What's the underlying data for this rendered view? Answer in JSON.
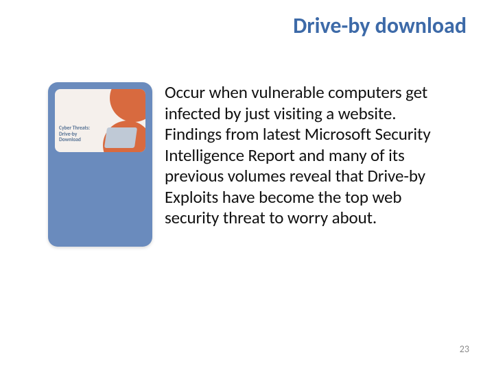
{
  "title": "Drive-by download",
  "body": "Occur when vulnerable computers get infected by just visiting a website. Findings from latest Microsoft Security Intelligence Report and many of its previous volumes reveal that Drive-by Exploits have become the top web security threat to worry about.",
  "image_caption_line1": "Cyber Threats:",
  "image_caption_line2": "Drive-by",
  "image_caption_line3": "Download",
  "page_number": "23"
}
